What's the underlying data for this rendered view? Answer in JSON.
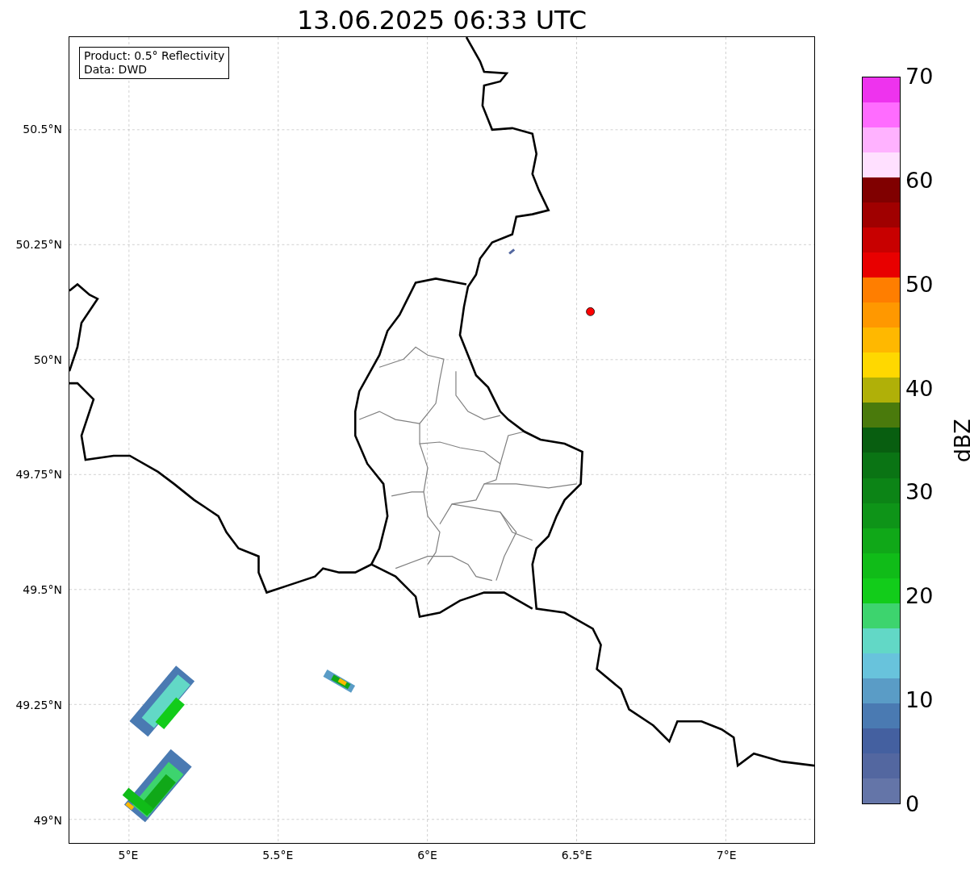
{
  "title": "13.06.2025 06:33 UTC",
  "info_box": [
    "Product: 0.5° Reflectivity",
    "Data: DWD"
  ],
  "map": {
    "x_ticks": [
      "5°E",
      "5.5°E",
      "6°E",
      "6.5°E",
      "7°E"
    ],
    "y_ticks": [
      "50.5°N",
      "50.25°N",
      "50°N",
      "49.75°N",
      "49.5°N",
      "49.25°N",
      "49°N"
    ]
  },
  "colorbar": {
    "label": "dBZ",
    "ticks": [
      "70",
      "60",
      "50",
      "40",
      "30",
      "20",
      "10",
      "0"
    ],
    "bins": [
      {
        "color": "#ee33ee"
      },
      {
        "color": "#ff6cff"
      },
      {
        "color": "#ffb2ff"
      },
      {
        "color": "#ffe0ff"
      },
      {
        "color": "#800000"
      },
      {
        "color": "#a00000"
      },
      {
        "color": "#c80000"
      },
      {
        "color": "#e80000"
      },
      {
        "color": "#ff7e00"
      },
      {
        "color": "#ff9800"
      },
      {
        "color": "#ffb800"
      },
      {
        "color": "#ffd800"
      },
      {
        "color": "#b0b008"
      },
      {
        "color": "#4a7a0c"
      },
      {
        "color": "#085e10"
      },
      {
        "color": "#0a7414"
      },
      {
        "color": "#0c8416"
      },
      {
        "color": "#0e9418"
      },
      {
        "color": "#10a818"
      },
      {
        "color": "#10bc18"
      },
      {
        "color": "#12cc1a"
      },
      {
        "color": "#3dd46e"
      },
      {
        "color": "#62d8c6"
      },
      {
        "color": "#68c3dc"
      },
      {
        "color": "#5a9cc6"
      },
      {
        "color": "#4a7ab2"
      },
      {
        "color": "#4460a0"
      },
      {
        "color": "#5367a0"
      },
      {
        "color": "#6475a8"
      }
    ]
  }
}
